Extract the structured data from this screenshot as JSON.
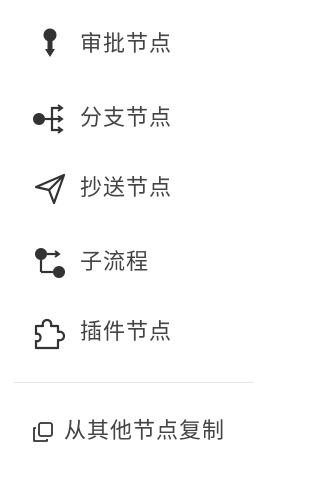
{
  "menu": {
    "items": [
      {
        "label": "审批节点",
        "icon": "approval-node-icon"
      },
      {
        "label": "分支节点",
        "icon": "branch-node-icon"
      },
      {
        "label": "抄送节点",
        "icon": "send-copy-icon"
      },
      {
        "label": "子流程",
        "icon": "subprocess-icon"
      },
      {
        "label": "插件节点",
        "icon": "plugin-puzzle-icon"
      }
    ],
    "copy_action": {
      "label": "从其他节点复制",
      "icon": "copy-icon"
    }
  },
  "colors": {
    "text": "#444444",
    "icon": "#333333",
    "divider": "#e6e6e6",
    "background": "#ffffff"
  }
}
